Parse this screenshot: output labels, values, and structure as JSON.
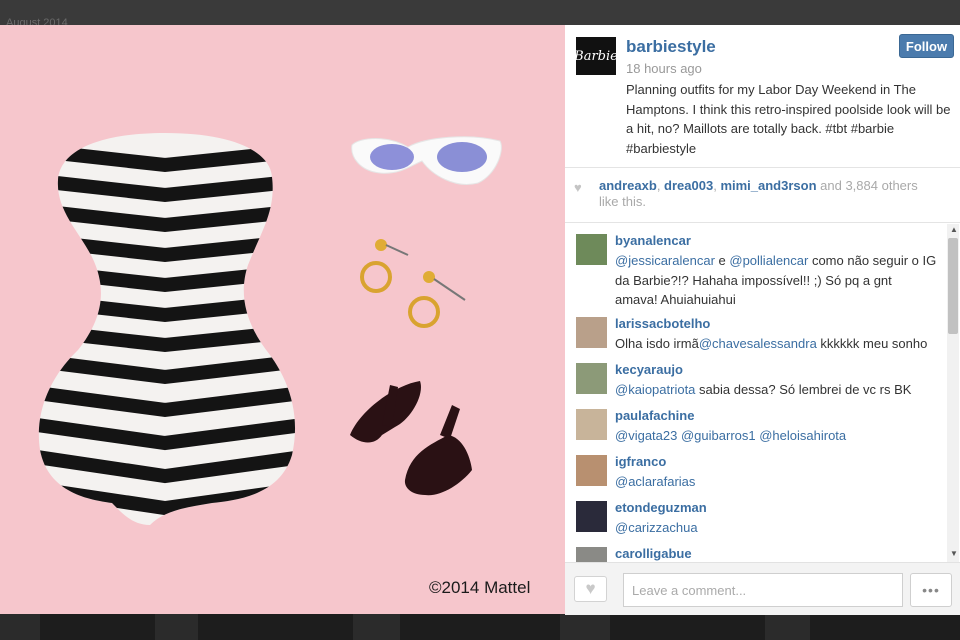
{
  "background": {
    "faded_label": "August 2014"
  },
  "photo": {
    "copyright": "©2014 Mattel",
    "background_color": "#f6c6cc"
  },
  "post": {
    "username": "barbiestyle",
    "time": "18 hours ago",
    "caption": "Planning outfits for my Labor Day Weekend in The Hamptons. I think this retro-inspired poolside look will be a hit, no? Maillots are totally back. #tbt #barbie #barbiestyle",
    "avatar_text": "Barbie",
    "follow_label": "Follow"
  },
  "likes": {
    "users": [
      "andreaxb",
      "drea003",
      "mimi_and3rson"
    ],
    "sep": ", ",
    "conj": " and ",
    "count": "3,884",
    "suffix": " others like this."
  },
  "comments": [
    {
      "user": "byanalencar",
      "parts": [
        {
          "m": "@jessicaralencar"
        },
        {
          "t": " e "
        },
        {
          "m": "@pollialencar"
        },
        {
          "t": " como não seguir o IG da Barbie?!? Hahaha impossível!! ;) Só pq a gnt amava! Ahuiahuiahui"
        }
      ]
    },
    {
      "user": "larissacbotelho",
      "parts": [
        {
          "t": "Olha isdo irmã"
        },
        {
          "m": "@chavesalessandra"
        },
        {
          "t": " kkkkkk meu sonho"
        }
      ]
    },
    {
      "user": "kecyaraujo",
      "parts": [
        {
          "m": "@kaiopatriota"
        },
        {
          "t": " sabia dessa? Só lembrei de vc rs BK"
        }
      ]
    },
    {
      "user": "paulafachine",
      "parts": [
        {
          "m": "@vigata23"
        },
        {
          "t": " "
        },
        {
          "m": "@guibarros1"
        },
        {
          "t": " "
        },
        {
          "m": "@heloisahirota"
        }
      ]
    },
    {
      "user": "igfranco",
      "parts": [
        {
          "m": "@aclarafarias"
        }
      ]
    },
    {
      "user": "etondeguzman",
      "parts": [
        {
          "m": "@carizzachua"
        }
      ]
    },
    {
      "user": "carolligabue",
      "parts": []
    }
  ],
  "comment_box": {
    "placeholder": "Leave a comment...",
    "more_label": "•••"
  },
  "icons": {
    "likes": "heart-icon",
    "like_button": "heart-icon",
    "more": "more-options-icon",
    "scroll_up": "arrow-up-icon",
    "scroll_down": "arrow-down-icon"
  },
  "colors": {
    "link": "#3b6ea2",
    "follow": "#4b7bad",
    "muted": "#a9a9a9"
  }
}
